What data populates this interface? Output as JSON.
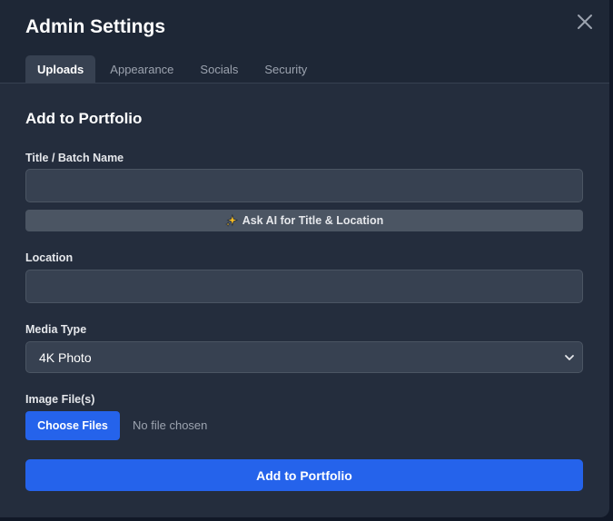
{
  "modal": {
    "title": "Admin Settings"
  },
  "tabs": [
    {
      "label": "Uploads",
      "active": true
    },
    {
      "label": "Appearance",
      "active": false
    },
    {
      "label": "Socials",
      "active": false
    },
    {
      "label": "Security",
      "active": false
    }
  ],
  "form": {
    "section_title": "Add to Portfolio",
    "title_label": "Title / Batch Name",
    "title_value": "",
    "ai_button_label": "Ask AI for Title & Location",
    "location_label": "Location",
    "location_value": "",
    "media_type_label": "Media Type",
    "media_type_value": "4K Photo",
    "image_label": "Image File(s)",
    "choose_files_label": "Choose Files",
    "no_file_text": "No file chosen",
    "submit_label": "Add to Portfolio"
  },
  "icons": {
    "close": "close-icon",
    "sparkle": "sparkle-icon",
    "chevron": "chevron-down-icon"
  },
  "colors": {
    "background": "#242d3d",
    "header": "#1e2736",
    "accent": "#2563eb",
    "input_bg": "#374151"
  }
}
